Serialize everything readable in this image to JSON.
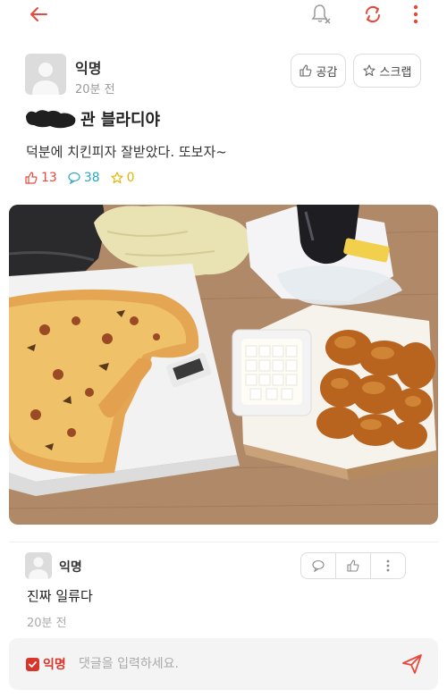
{
  "colors": {
    "accent": "#e8483b",
    "comments": "#2aa7c2",
    "scraps": "#e3b700"
  },
  "topbar": {
    "icons": [
      "back-arrow-icon",
      "bell-off-icon",
      "refresh-icon",
      "more-vertical-icon"
    ]
  },
  "post": {
    "author": "익명",
    "time": "20분 전",
    "like_label": "공감",
    "scrap_label": "스크랩",
    "title": "관 블라디야",
    "body": "덕분에 치킨피자 잘받았다. 또보자~",
    "stats": {
      "likes": "13",
      "comments": "38",
      "scraps": "0"
    }
  },
  "comment": {
    "author": "익명",
    "text": "진짜 일류다",
    "time": "20분 전"
  },
  "input_bar": {
    "anonymous_label": "익명",
    "placeholder": "댓글을 입력하세요."
  }
}
